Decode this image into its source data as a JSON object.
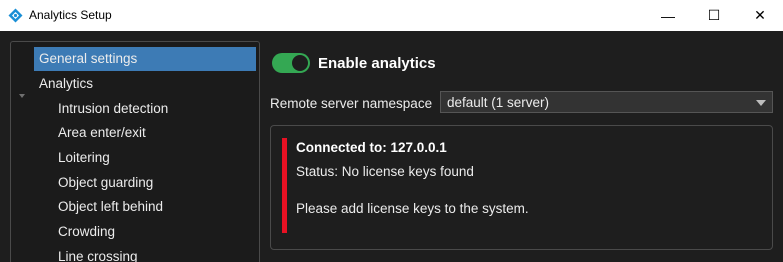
{
  "window": {
    "title": "Analytics Setup",
    "controls": {
      "minimize": "—",
      "maximize": "☐",
      "close": "✕"
    },
    "icon": "diamond-app-icon"
  },
  "tree": {
    "items": [
      {
        "label": "General settings",
        "selected": true
      },
      {
        "label": "Analytics",
        "expandable": true
      },
      {
        "label": "Intrusion detection"
      },
      {
        "label": "Area enter/exit"
      },
      {
        "label": "Loitering"
      },
      {
        "label": "Object guarding"
      },
      {
        "label": "Object left behind"
      },
      {
        "label": "Crowding"
      },
      {
        "label": "Line crossing"
      }
    ]
  },
  "settings": {
    "enable_analytics_label": "Enable analytics",
    "enable_analytics_on": true,
    "namespace_label": "Remote server namespace",
    "namespace_value": "default (1 server)"
  },
  "status": {
    "connected": "Connected to: 127.0.0.1",
    "status_line": "Status: No license keys found",
    "message": "Please add license keys to the system."
  },
  "colors": {
    "accent_selected": "#3d7bb5",
    "toggle_on": "#34a853",
    "error_bar": "#e81123"
  }
}
